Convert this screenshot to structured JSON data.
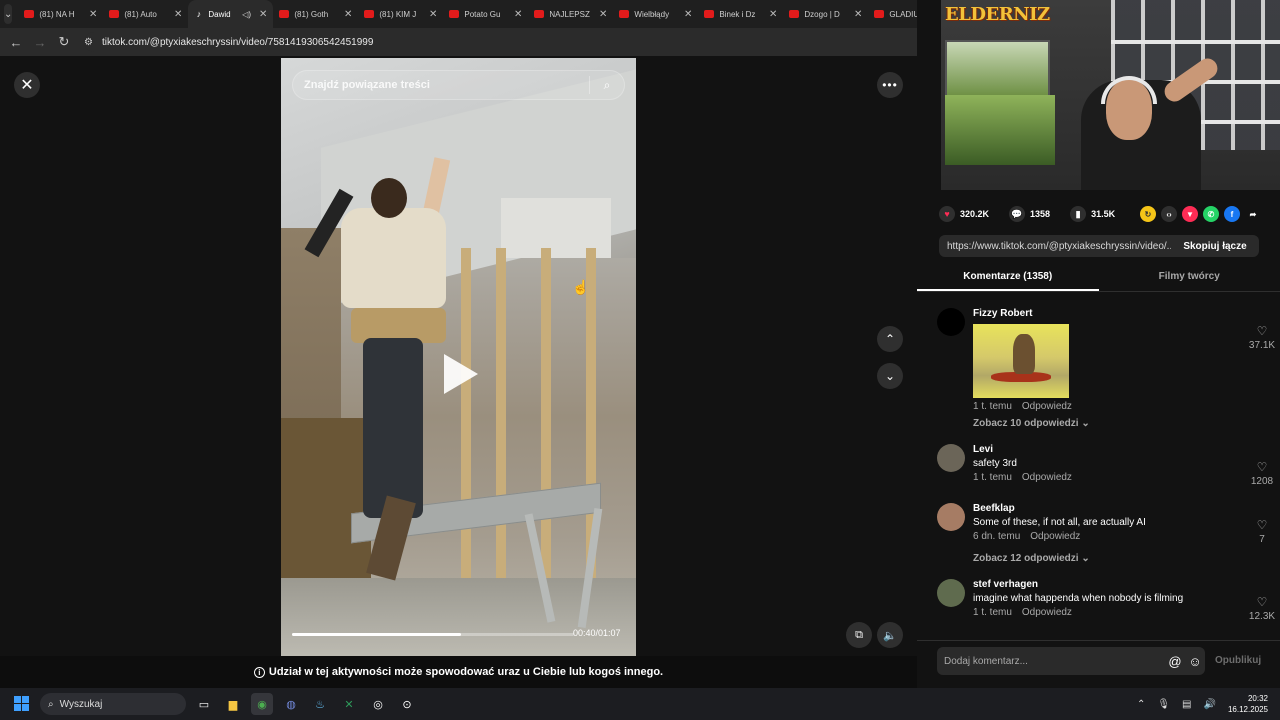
{
  "browser": {
    "tabs": [
      {
        "title": "(81) NA H",
        "icon": "youtube-icon",
        "active": false
      },
      {
        "title": "(81) Auto",
        "icon": "youtube-icon",
        "active": false
      },
      {
        "title": "Dawid",
        "icon": "tiktok-icon",
        "active": true
      },
      {
        "title": "(81) Goth",
        "icon": "youtube-icon",
        "active": false
      },
      {
        "title": "(81) KIM J",
        "icon": "youtube-icon",
        "active": false
      },
      {
        "title": "Potato Gu",
        "icon": "youtube-icon",
        "active": false
      },
      {
        "title": "NAJLEPSZ",
        "icon": "youtube-icon",
        "active": false
      },
      {
        "title": "Wielbłądy",
        "icon": "youtube-icon",
        "active": false
      },
      {
        "title": "Binek i Dz",
        "icon": "youtube-icon",
        "active": false
      },
      {
        "title": "Dzogo | D",
        "icon": "youtube-icon",
        "active": false
      },
      {
        "title": "GLADIUS",
        "icon": "youtube-icon",
        "active": false
      }
    ],
    "url": "tiktok.com/@ptyxiakeschryssin/video/7581419306542451999"
  },
  "video": {
    "search_placeholder": "Znajdź powiązane treści",
    "time": "00:40/01:07",
    "progress": 0.6,
    "warning": "Udział w tej aktywności może spowodować uraz u Ciebie lub kogoś innego."
  },
  "webcam": {
    "logo": "ELDERNIZ"
  },
  "stats": {
    "likes": "320.2K",
    "comments": "1358",
    "saves": "31.5K"
  },
  "share": {
    "link": "https://www.tiktok.com/@ptyxiakeschryssin/video/...",
    "copy_label": "Skopiuj łącze"
  },
  "panel_tabs": {
    "comments": "Komentarze (1358)",
    "creator_videos": "Filmy twórcy"
  },
  "comments": [
    {
      "name": "Fizzy Robert",
      "text": "",
      "time": "1 t. temu",
      "reply": "Odpowiedz",
      "likes": "37.1K",
      "more": "Zobacz 10 odpowiedzi"
    },
    {
      "name": "Levi",
      "text": "safety 3rd",
      "time": "1 t. temu",
      "reply": "Odpowiedz",
      "likes": "1208",
      "more": ""
    },
    {
      "name": "Beefklap",
      "text": "Some of these, if not all, are actually AI",
      "time": "6 dn. temu",
      "reply": "Odpowiedz",
      "likes": "7",
      "more": "Zobacz 12 odpowiedzi"
    },
    {
      "name": "stef verhagen",
      "text": "imagine what happenda when nobody is filming",
      "time": "1 t. temu",
      "reply": "Odpowiedz",
      "likes": "12.3K",
      "more": ""
    }
  ],
  "comment_input": {
    "placeholder": "Dodaj komentarz...",
    "publish": "Opublikuj"
  },
  "taskbar": {
    "search": "Wyszukaj",
    "time": "20:32",
    "date": "16.12.2025"
  }
}
